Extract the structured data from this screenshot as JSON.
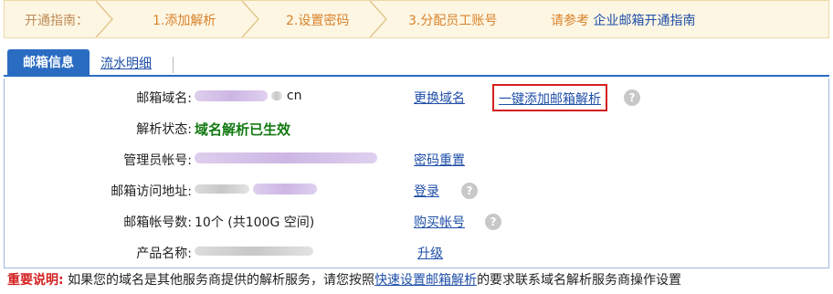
{
  "guide": {
    "title": "开通指南：",
    "steps": [
      "1.添加解析",
      "2.设置密码",
      "3.分配员工账号"
    ],
    "ref_prefix": "请参考",
    "ref_link": "企业邮箱开通指南",
    "background": "#fdf6e3",
    "step_color": "#d9822b"
  },
  "tabs": {
    "active": "邮箱信息",
    "inactive": "流水明细",
    "accent": "#2a6cc2"
  },
  "info": {
    "domain": {
      "label": "邮箱域名:",
      "value_suffix": "cn",
      "action": "更换域名",
      "action2": "一键添加邮箱解析",
      "help_icon": "question-circle-icon"
    },
    "status": {
      "label": "解析状态:",
      "value": "域名解析已生效",
      "value_color": "#137a13"
    },
    "admin": {
      "label": "管理员帐号:",
      "action": "密码重置"
    },
    "access": {
      "label": "邮箱访问地址:",
      "action": "登录",
      "help_icon": "question-circle-icon"
    },
    "accounts": {
      "label": "邮箱帐号数:",
      "value": "10个 (共100G 空间)",
      "action": "购买帐号",
      "help_icon": "question-circle-icon"
    },
    "product": {
      "label": "产品名称:",
      "action": "升级"
    }
  },
  "note": {
    "title": "重要说明:",
    "text_before": "如果您的域名是其他服务商提供的解析服务，请您按照",
    "link": "快速设置邮箱解析",
    "text_after": "的要求联系域名解析服务商操作设置"
  }
}
